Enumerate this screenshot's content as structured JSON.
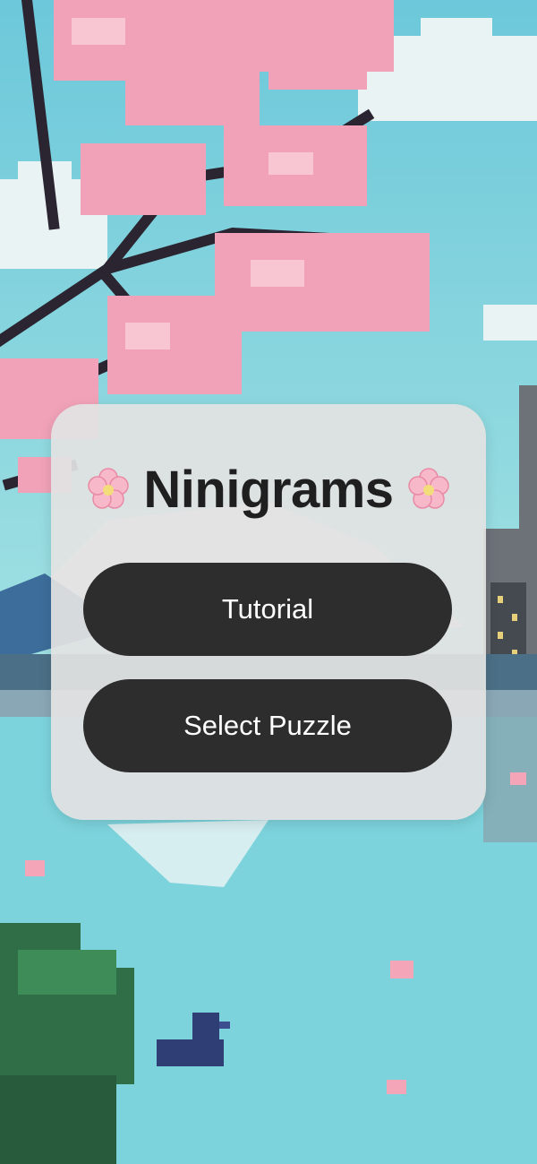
{
  "app": {
    "title": "Ninigrams",
    "title_icon": "cherry-blossom-icon"
  },
  "menu": {
    "tutorial_label": "Tutorial",
    "select_puzzle_label": "Select Puzzle"
  },
  "colors": {
    "sky": "#7fd3de",
    "water": "#8fdcdf",
    "blossom": "#f0a0b8",
    "branch": "#2a2530",
    "card": "#e2e2e2",
    "button": "#2d2d2d",
    "button_text": "#ffffff",
    "title_text": "#1f1f1f"
  }
}
